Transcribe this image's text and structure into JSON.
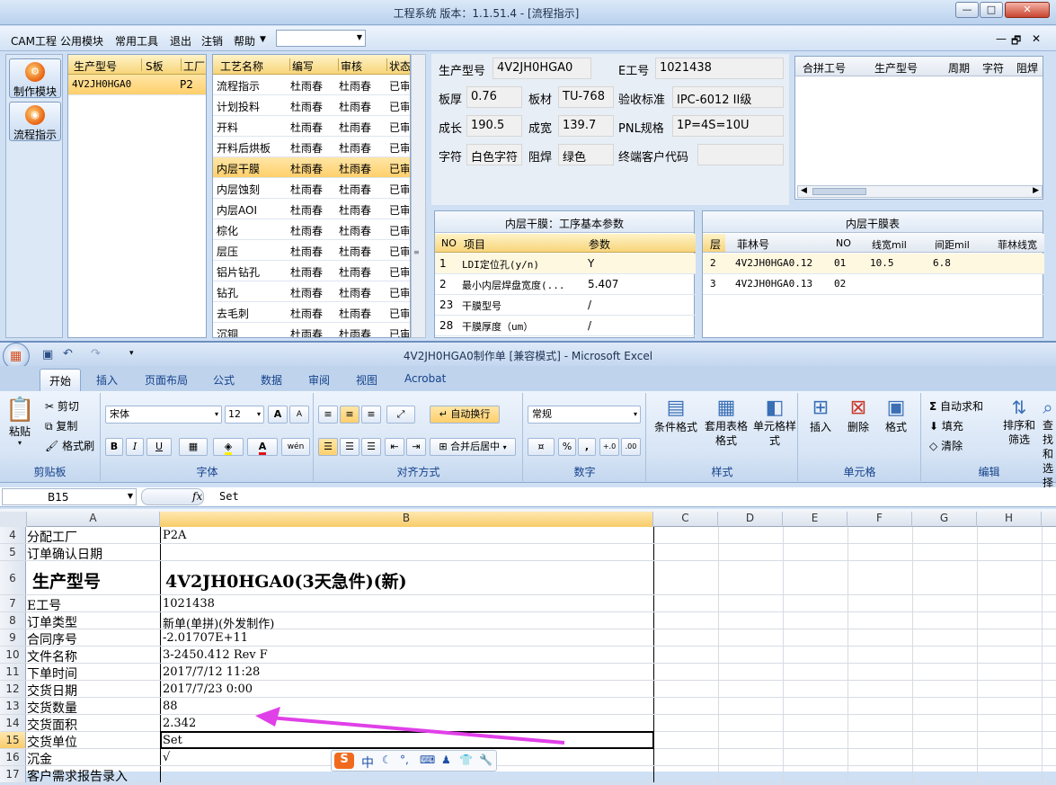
{
  "app": {
    "title": "工程系统   版本：1.1.51.4 - [流程指示]",
    "window_buttons": [
      "—",
      "□",
      "✕"
    ],
    "menu": [
      "CAM工程",
      "公用模块",
      "常用工具",
      "退出",
      "注销",
      "帮助"
    ],
    "combo_value": "",
    "mdi_buttons": [
      "—",
      "🗗",
      "✕"
    ]
  },
  "nav": [
    {
      "label": "制作模块",
      "icon": "gear-icon"
    },
    {
      "label": "流程指示",
      "icon": "flow-icon"
    }
  ],
  "model_grid": {
    "headers": [
      "生产型号",
      "S板",
      "工厂"
    ],
    "rows": [
      [
        "4V2JH0HGA0",
        "",
        "P2"
      ]
    ]
  },
  "process_grid": {
    "headers": [
      "工艺名称",
      "编写",
      "审核",
      "状态"
    ],
    "rows": [
      [
        "流程指示",
        "杜雨春",
        "杜雨春",
        "已审"
      ],
      [
        "计划投料",
        "杜雨春",
        "杜雨春",
        "已审"
      ],
      [
        "开料",
        "杜雨春",
        "杜雨春",
        "已审"
      ],
      [
        "开料后烘板",
        "杜雨春",
        "杜雨春",
        "已审"
      ],
      [
        "内层干膜",
        "杜雨春",
        "杜雨春",
        "已审"
      ],
      [
        "内层蚀刻",
        "杜雨春",
        "杜雨春",
        "已审"
      ],
      [
        "内层AOI",
        "杜雨春",
        "杜雨春",
        "已审"
      ],
      [
        "棕化",
        "杜雨春",
        "杜雨春",
        "已审"
      ],
      [
        "层压",
        "杜雨春",
        "杜雨春",
        "已审"
      ],
      [
        "铝片钻孔",
        "杜雨春",
        "杜雨春",
        "已审"
      ],
      [
        "钻孔",
        "杜雨春",
        "杜雨春",
        "已审"
      ],
      [
        "去毛刺",
        "杜雨春",
        "杜雨春",
        "已审"
      ],
      [
        "沉铜",
        "杜雨春",
        "杜雨春",
        "已审"
      ]
    ],
    "selected_index": 4
  },
  "info": {
    "model_label": "生产型号",
    "model_value": "4V2JH0HGA0",
    "eno_label": "E工号",
    "eno_value": "1021438",
    "thick_label": "板厚",
    "thick_value": "0.76",
    "material_label": "板材",
    "material_value": "TU-768",
    "std_label": "验收标准",
    "std_value": "IPC-6012 II级",
    "length_label": "成长",
    "length_value": "190.5",
    "width_label": "成宽",
    "width_value": "139.7",
    "pnl_label": "PNL规格",
    "pnl_value": "1P=4S=10U",
    "char_label": "字符",
    "char_value": "白色字符",
    "mask_label": "阻焊",
    "mask_value": "绿色",
    "customer_label": "终端客户代码",
    "customer_value": ""
  },
  "merge_grid": {
    "headers": [
      "合拼工号",
      "生产型号",
      "周期",
      "字符",
      "阻焊"
    ]
  },
  "params": {
    "title": "内层干膜：工序基本参数",
    "headers": [
      "NO",
      "项目",
      "参数"
    ],
    "rows": [
      [
        "1",
        "LDI定位孔(y/n)",
        "Y"
      ],
      [
        "2",
        "最小内层焊盘宽度(...",
        "5.407"
      ],
      [
        "23",
        "干膜型号",
        "/"
      ],
      [
        "28",
        "干膜厚度（um）",
        "/"
      ]
    ]
  },
  "film": {
    "title": "内层干膜表",
    "headers": [
      "层",
      "菲林号",
      "NO",
      "线宽mil",
      "间距mil",
      "菲林线宽"
    ],
    "rows": [
      [
        "2",
        "4V2JH0HGA0.12",
        "01",
        "10.5",
        "6.8",
        ""
      ],
      [
        "3",
        "4V2JH0HGA0.13",
        "02",
        "",
        "",
        ""
      ]
    ]
  },
  "excel": {
    "title": "4V2JH0HGA0制作单  [兼容模式] - Microsoft Excel",
    "qat": [
      "↶",
      "↷"
    ],
    "tabs": [
      "开始",
      "插入",
      "页面布局",
      "公式",
      "数据",
      "审阅",
      "视图",
      "Acrobat"
    ],
    "active_tab": "开始",
    "clipboard": {
      "paste": "粘贴",
      "cut": "剪切",
      "copy": "复制",
      "painter": "格式刷",
      "label": "剪贴板"
    },
    "font": {
      "name": "宋体",
      "size": "12",
      "label": "字体",
      "bold": "B",
      "italic": "I",
      "underline": "U",
      "grow": "A",
      "shrink": "A",
      "color_a": "A",
      "phonetic": "wén"
    },
    "align": {
      "wrap": "自动换行",
      "merge": "合并后居中",
      "label": "对齐方式"
    },
    "number": {
      "format": "常规",
      "pct": "%",
      "comma": ",",
      "inc": "+.0",
      "dec": ".00",
      "label": "数字"
    },
    "styles": {
      "cond": "条件格式",
      "table": "套用表格格式",
      "cell": "单元格样式",
      "label": "样式"
    },
    "cells": {
      "insert": "插入",
      "delete": "删除",
      "format": "格式",
      "label": "单元格"
    },
    "editing": {
      "sum": "自动求和",
      "fill": "填充",
      "clear": "清除",
      "sort": "排序和筛选",
      "find": "查找和选择",
      "label": "编辑"
    },
    "name_box": "B15",
    "fx": "fx",
    "formula": "Set",
    "columns": [
      "A",
      "B",
      "C",
      "D",
      "E",
      "F",
      "G",
      "H"
    ],
    "rows": [
      {
        "n": "4",
        "a": "分配工厂",
        "b": "P2A"
      },
      {
        "n": "5",
        "a": "订单确认日期",
        "b": ""
      },
      {
        "n": "6",
        "a": "生产型号",
        "b": "4V2JH0HGA0(3天急件)(新)"
      },
      {
        "n": "7",
        "a": "E工号",
        "b": "1021438"
      },
      {
        "n": "8",
        "a": "订单类型",
        "b": "新单(单拼)(外发制作)"
      },
      {
        "n": "9",
        "a": "合同序号",
        "b": "-2.01707E+11"
      },
      {
        "n": "10",
        "a": "文件名称",
        "b": "3-2450.412 Rev F"
      },
      {
        "n": "11",
        "a": "下单时间",
        "b": "2017/7/12 11:28"
      },
      {
        "n": "12",
        "a": "交货日期",
        "b": "2017/7/23 0:00"
      },
      {
        "n": "13",
        "a": "交货数量",
        "b": "88"
      },
      {
        "n": "14",
        "a": "交货面积",
        "b": "2.342"
      },
      {
        "n": "15",
        "a": "交货单位",
        "b": "Set"
      },
      {
        "n": "16",
        "a": "沉金",
        "b": "√"
      },
      {
        "n": "17",
        "a": "客户需求报告录入",
        "b": ""
      }
    ],
    "arrow_color": "#e040e8"
  },
  "ime": {
    "logo": "S",
    "mode": "中"
  }
}
